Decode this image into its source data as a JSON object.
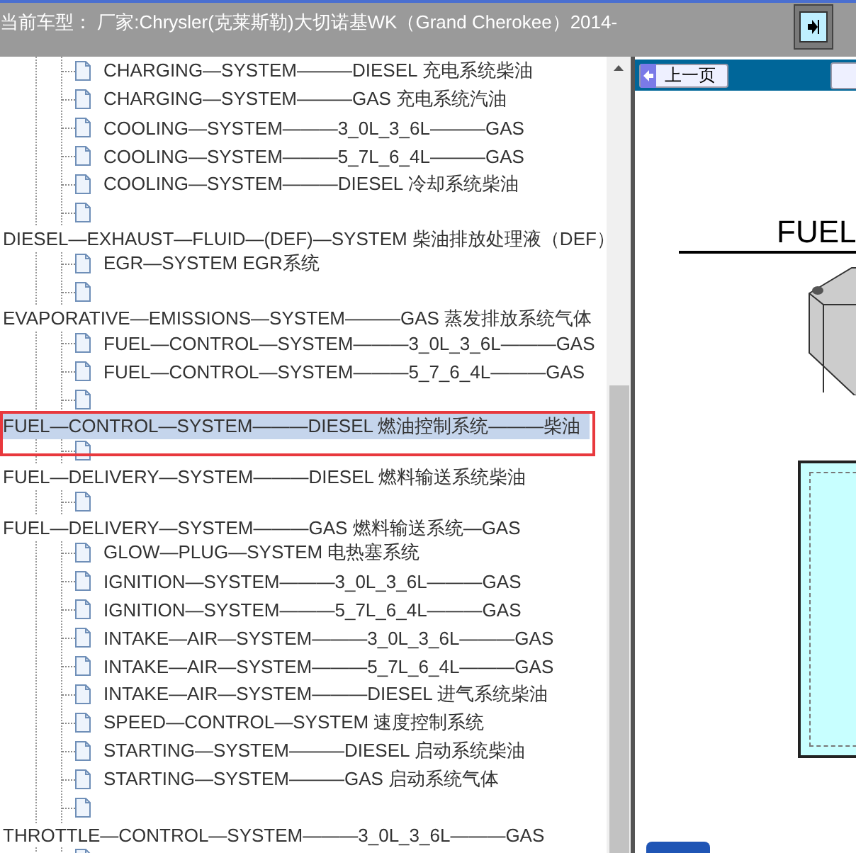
{
  "header": {
    "title": "当前车型： 厂家:Chrysler(克莱斯勒)大切诺基WK（Grand Cherokee）2014-"
  },
  "tree": {
    "items": [
      {
        "kind": "inline",
        "label": "CHARGING—SYSTEM———DIESEL 充电系统柴油",
        "selected": false
      },
      {
        "kind": "inline",
        "label": "CHARGING—SYSTEM———GAS 充电系统汽油",
        "selected": false
      },
      {
        "kind": "inline",
        "label": "COOLING—SYSTEM———3_0L_3_6L———GAS",
        "selected": false
      },
      {
        "kind": "inline",
        "label": "COOLING—SYSTEM———5_7L_6_4L———GAS",
        "selected": false
      },
      {
        "kind": "inline",
        "label": "COOLING—SYSTEM———DIESEL 冷却系统柴油",
        "selected": false
      },
      {
        "kind": "wrapped",
        "label": "DIESEL—EXHAUST—FLUID—(DEF)—SYSTEM 柴油排放处理液（DEF）",
        "selected": false
      },
      {
        "kind": "inline",
        "label": "EGR—SYSTEM EGR系统",
        "selected": false
      },
      {
        "kind": "wrapped",
        "label": "EVAPORATIVE—EMISSIONS—SYSTEM———GAS 蒸发排放系统气体",
        "selected": false
      },
      {
        "kind": "inline",
        "label": "FUEL—CONTROL—SYSTEM———3_0L_3_6L———GAS",
        "selected": false
      },
      {
        "kind": "inline",
        "label": "FUEL—CONTROL—SYSTEM———5_7_6_4L———GAS",
        "selected": false
      },
      {
        "kind": "wrapped",
        "label": "FUEL—CONTROL—SYSTEM———DIESEL 燃油控制系统———柴油",
        "selected": true
      },
      {
        "kind": "wrapped",
        "label": "FUEL—DELIVERY—SYSTEM———DIESEL 燃料输送系统柴油",
        "selected": false
      },
      {
        "kind": "wrapped",
        "label": "FUEL—DELIVERY—SYSTEM———GAS 燃料输送系统—GAS",
        "selected": false
      },
      {
        "kind": "inline",
        "label": "GLOW—PLUG—SYSTEM 电热塞系统",
        "selected": false
      },
      {
        "kind": "inline",
        "label": "IGNITION—SYSTEM———3_0L_3_6L———GAS",
        "selected": false
      },
      {
        "kind": "inline",
        "label": "IGNITION—SYSTEM———5_7L_6_4L———GAS",
        "selected": false
      },
      {
        "kind": "inline",
        "label": "INTAKE—AIR—SYSTEM———3_0L_3_6L———GAS",
        "selected": false
      },
      {
        "kind": "inline",
        "label": "INTAKE—AIR—SYSTEM———5_7L_6_4L———GAS",
        "selected": false
      },
      {
        "kind": "inline",
        "label": "INTAKE—AIR—SYSTEM———DIESEL 进气系统柴油",
        "selected": false
      },
      {
        "kind": "inline",
        "label": "SPEED—CONTROL—SYSTEM 速度控制系统",
        "selected": false
      },
      {
        "kind": "inline",
        "label": "STARTING—SYSTEM———DIESEL 启动系统柴油",
        "selected": false
      },
      {
        "kind": "inline",
        "label": "STARTING—SYSTEM———GAS 启动系统气体",
        "selected": false
      },
      {
        "kind": "wrapped",
        "label": "THROTTLE—CONTROL—SYSTEM———3_0L_3_6L———GAS",
        "selected": false
      },
      {
        "kind": "wrapped"
      }
    ]
  },
  "viewer": {
    "prev_button": "上一页",
    "heading": "FUEL"
  }
}
